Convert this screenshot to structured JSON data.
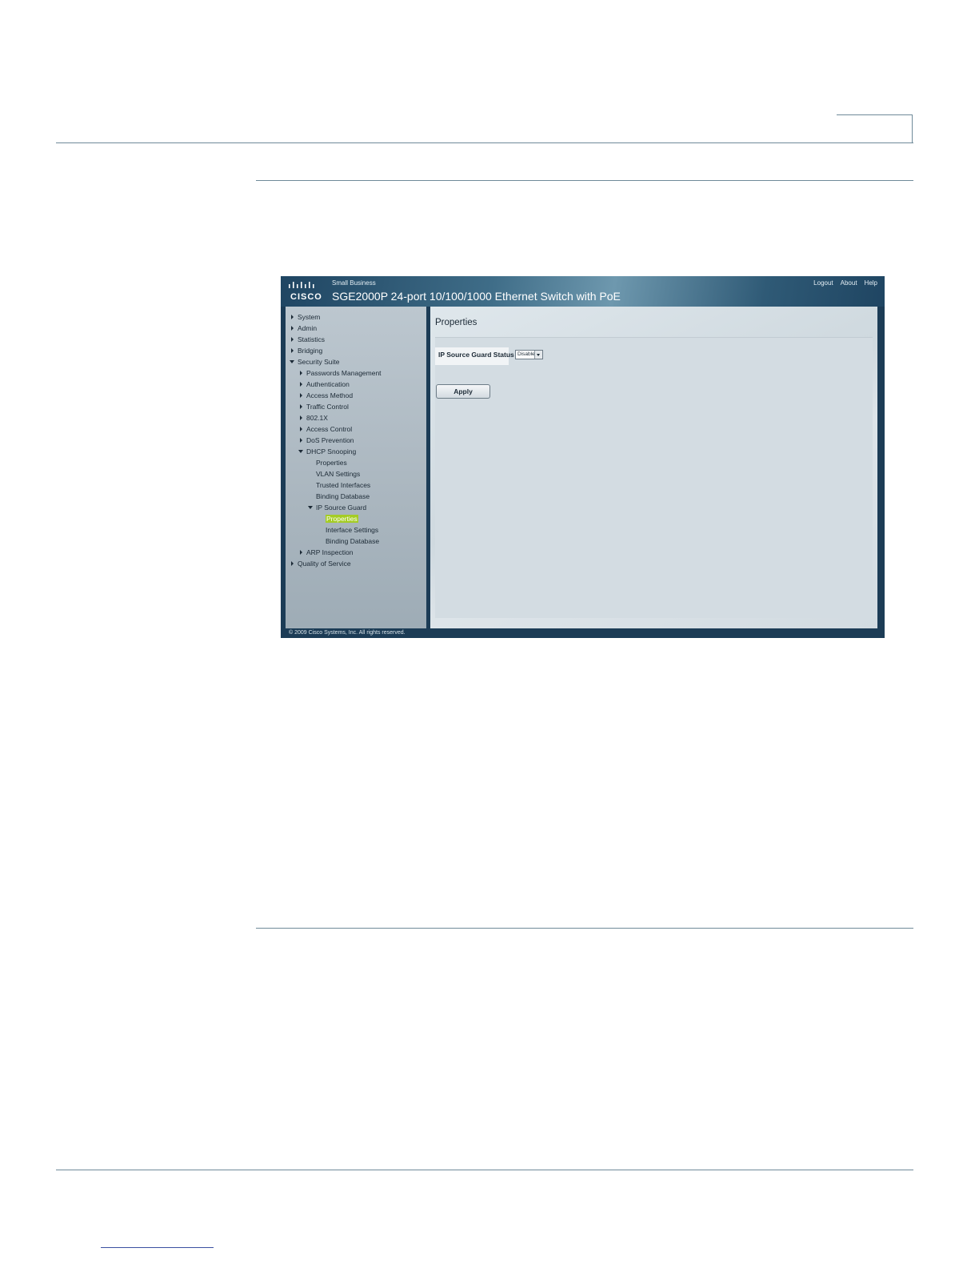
{
  "header": {
    "logo_text": "CISCO",
    "brand_line": "Small Business",
    "product_title": "SGE2000P 24-port 10/100/1000 Ethernet Switch with PoE",
    "links": [
      "Logout",
      "About",
      "Help"
    ]
  },
  "nav": {
    "items": [
      {
        "label": "System",
        "icon": "arrow-right-icon"
      },
      {
        "label": "Admin",
        "icon": "arrow-right-icon"
      },
      {
        "label": "Statistics",
        "icon": "arrow-right-icon"
      },
      {
        "label": "Bridging",
        "icon": "arrow-right-icon"
      },
      {
        "label": "Security Suite",
        "icon": "arrow-down-icon"
      },
      {
        "label": "Passwords Management",
        "icon": "arrow-right-icon"
      },
      {
        "label": "Authentication",
        "icon": "arrow-right-icon"
      },
      {
        "label": "Access Method",
        "icon": "arrow-right-icon"
      },
      {
        "label": "Traffic Control",
        "icon": "arrow-right-icon"
      },
      {
        "label": "802.1X",
        "icon": "arrow-right-icon"
      },
      {
        "label": "Access Control",
        "icon": "arrow-right-icon"
      },
      {
        "label": "DoS Prevention",
        "icon": "arrow-right-icon"
      },
      {
        "label": "DHCP Snooping",
        "icon": "arrow-down-icon"
      },
      {
        "label": "Properties",
        "icon": ""
      },
      {
        "label": "VLAN Settings",
        "icon": ""
      },
      {
        "label": "Trusted Interfaces",
        "icon": ""
      },
      {
        "label": "Binding Database",
        "icon": ""
      },
      {
        "label": "IP Source Guard",
        "icon": "arrow-down-icon"
      },
      {
        "label": "Properties",
        "icon": "",
        "active": true
      },
      {
        "label": "Interface Settings",
        "icon": ""
      },
      {
        "label": "Binding Database",
        "icon": ""
      },
      {
        "label": "ARP Inspection",
        "icon": "arrow-right-icon"
      },
      {
        "label": "Quality of Service",
        "icon": "arrow-right-icon"
      }
    ]
  },
  "content": {
    "title": "Properties",
    "field_label": "IP Source Guard Status",
    "select_value": "Disable",
    "apply_label": "Apply"
  },
  "footer": {
    "copyright": "© 2009 Cisco Systems, Inc. All rights reserved."
  },
  "colors": {
    "header_dark": "#1f4562",
    "active_highlight": "#a4cc24",
    "rule": "#6f8a99"
  }
}
